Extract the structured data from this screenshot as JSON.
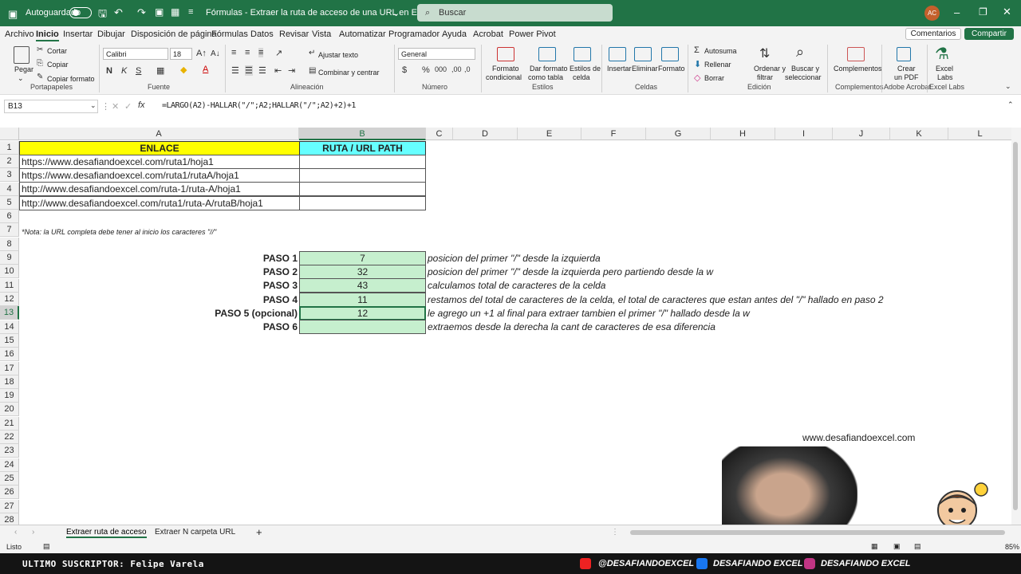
{
  "titlebar": {
    "autosave_label": "Autoguardado",
    "title": "Fórmulas - Extraer la ruta de acceso de una URL en Excel (STREA...",
    "search_placeholder": "Buscar",
    "avatar_initials": "AC"
  },
  "menu": {
    "items": [
      "Archivo",
      "Inicio",
      "Insertar",
      "Dibujar",
      "Disposición de página",
      "Fórmulas",
      "Datos",
      "Revisar",
      "Vista",
      "Automatizar",
      "Programador",
      "Ayuda",
      "Acrobat",
      "Power Pivot"
    ],
    "active": "Inicio",
    "comments": "Comentarios",
    "share": "Compartir"
  },
  "ribbon": {
    "paste": "Pegar",
    "cut": "Cortar",
    "copy": "Copiar",
    "format_painter": "Copiar formato",
    "group_clipboard": "Portapapeles",
    "font_name": "Calibri",
    "font_size": "18",
    "bold": "N",
    "italic": "K",
    "underline": "S",
    "group_font": "Fuente",
    "wrap_text": "Ajustar texto",
    "merge_center": "Combinar y centrar",
    "group_alignment": "Alineación",
    "number_format": "General",
    "group_number": "Número",
    "cond_format_1": "Formato",
    "cond_format_2": "condicional",
    "table_format_1": "Dar formato",
    "table_format_2": "como tabla",
    "cell_styles_1": "Estilos de",
    "cell_styles_2": "celda",
    "group_styles": "Estilos",
    "insert": "Insertar",
    "delete": "Eliminar",
    "format": "Formato",
    "group_cells": "Celdas",
    "autosum": "Autosuma",
    "fill": "Rellenar",
    "clear": "Borrar",
    "sort_1": "Ordenar y",
    "sort_2": "filtrar",
    "find_1": "Buscar y",
    "find_2": "seleccionar",
    "group_editing": "Edición",
    "addins": "Complementos",
    "group_addins": "Complementos",
    "pdf_1": "Crear",
    "pdf_2": "un PDF",
    "group_acrobat": "Adobe Acrobat",
    "labs_1": "Excel",
    "labs_2": "Labs",
    "group_labs": "Excel Labs"
  },
  "formula_bar": {
    "name_box": "B13",
    "fx": "fx",
    "formula": "=LARGO(A2)-HALLAR(\"/\";A2;HALLAR(\"/\";A2)+2)+1"
  },
  "columns": [
    "A",
    "B",
    "C",
    "D",
    "E",
    "F",
    "G",
    "H",
    "I",
    "J",
    "K",
    "L"
  ],
  "rows": [
    "1",
    "2",
    "3",
    "4",
    "5",
    "6",
    "7",
    "8",
    "9",
    "10",
    "11",
    "12",
    "13",
    "14",
    "15",
    "16",
    "17",
    "18",
    "19",
    "20",
    "21",
    "22",
    "23",
    "24",
    "25",
    "26",
    "27",
    "28"
  ],
  "sheet": {
    "header_a": "ENLACE",
    "header_b": "RUTA / URL PATH",
    "urls": [
      "https://www.desafiandoexcel.com/ruta1/hoja1",
      "https://www.desafiandoexcel.com/ruta1/rutaA/hoja1",
      "http://www.desafiandoexcel.com/ruta-1/ruta-A/hoja1",
      "http://www.desafiandoexcel.com/ruta1/ruta-A/rutaB/hoja1"
    ],
    "note": "*Nota: la URL completa debe tener al inicio los caracteres \"//\"",
    "steps": [
      {
        "label": "PASO 1",
        "value": "7",
        "desc": "posicion del primer \"/\" desde la izquierda"
      },
      {
        "label": "PASO 2",
        "value": "32",
        "desc": "posicion del primer \"/\" desde la izquierda pero partiendo desde la w"
      },
      {
        "label": "PASO 3",
        "value": "43",
        "desc": "calculamos total de caracteres de la celda"
      },
      {
        "label": "PASO 4",
        "value": "11",
        "desc": "restamos del total de caracteres de la celda, el total de caracteres que estan antes del \"/\" hallado en paso 2"
      },
      {
        "label": "PASO 5 (opcional)",
        "value": "12",
        "desc": "le agrego un +1 al final para extraer tambien el primer \"/\" hallado desde la w"
      },
      {
        "label": "PASO 6",
        "value": "",
        "desc": "extraemos desde la derecha la cant de caracteres de esa diferencia"
      }
    ],
    "website": "www.desafiandoexcel.com"
  },
  "tabs": {
    "items": [
      "Extraer ruta de acceso",
      "Extraer N carpeta URL"
    ],
    "active": "Extraer ruta de acceso"
  },
  "status": {
    "ready": "Listo",
    "zoom": "85%"
  },
  "banner": {
    "subscriber": "ULTIMO SUSCRIPTOR: Felipe Varela",
    "youtube": "@DESAFIANDOEXCEL",
    "facebook": "DESAFIANDO EXCEL",
    "instagram": "DESAFIANDO EXCEL"
  },
  "colors": {
    "excel_green": "#217346",
    "header_yellow": "#ffff00",
    "header_cyan": "#66ffff",
    "step_green": "#c6efce"
  }
}
